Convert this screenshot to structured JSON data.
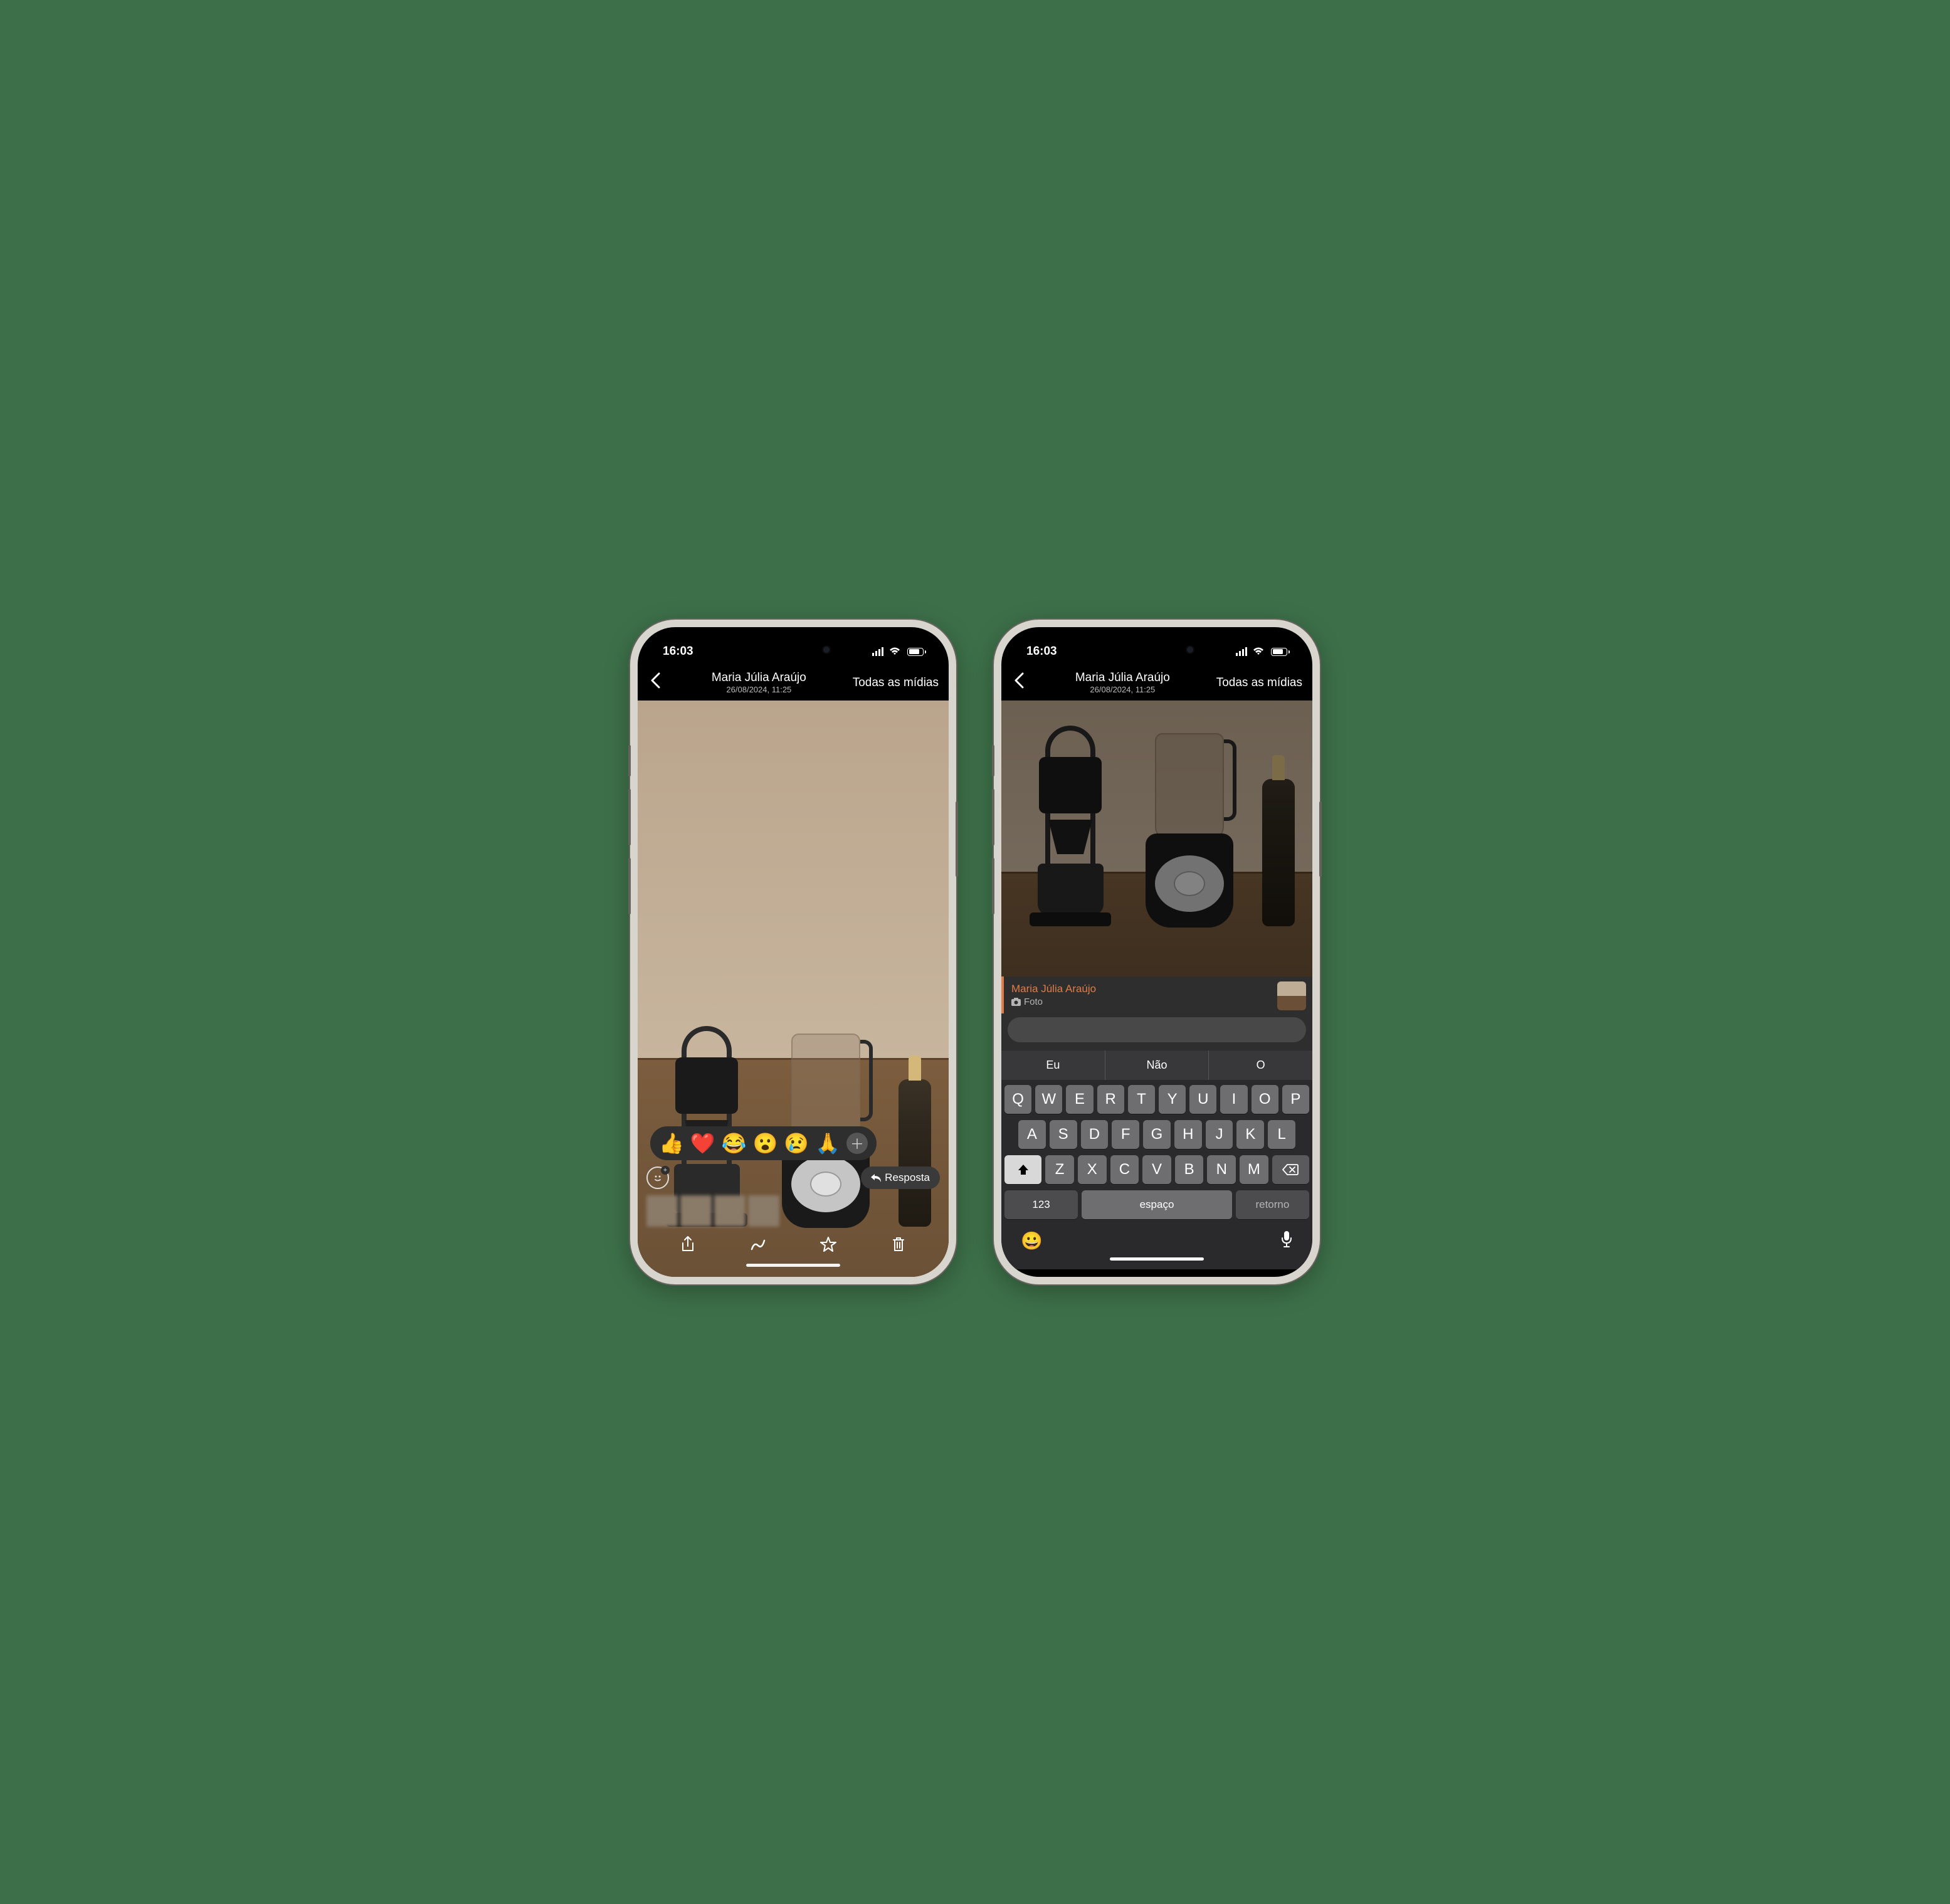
{
  "status": {
    "time": "16:03"
  },
  "header": {
    "contact": "Maria Júlia Araújo",
    "datetime": "26/08/2024, 11:25",
    "all_media": "Todas as mídias"
  },
  "reactions": [
    "👍",
    "❤️",
    "😂",
    "😮",
    "😢",
    "🙏"
  ],
  "reply_button": "Resposta",
  "reply_context": {
    "name": "Maria Júlia Araújo",
    "type_label": "Foto"
  },
  "keyboard": {
    "suggestions": [
      "Eu",
      "Não",
      "O"
    ],
    "row1": [
      "Q",
      "W",
      "E",
      "R",
      "T",
      "Y",
      "U",
      "I",
      "O",
      "P"
    ],
    "row2": [
      "A",
      "S",
      "D",
      "F",
      "G",
      "H",
      "J",
      "K",
      "L"
    ],
    "row3": [
      "Z",
      "X",
      "C",
      "V",
      "B",
      "N",
      "M"
    ],
    "numbers_key": "123",
    "space_key": "espaço",
    "return_key": "retorno"
  }
}
